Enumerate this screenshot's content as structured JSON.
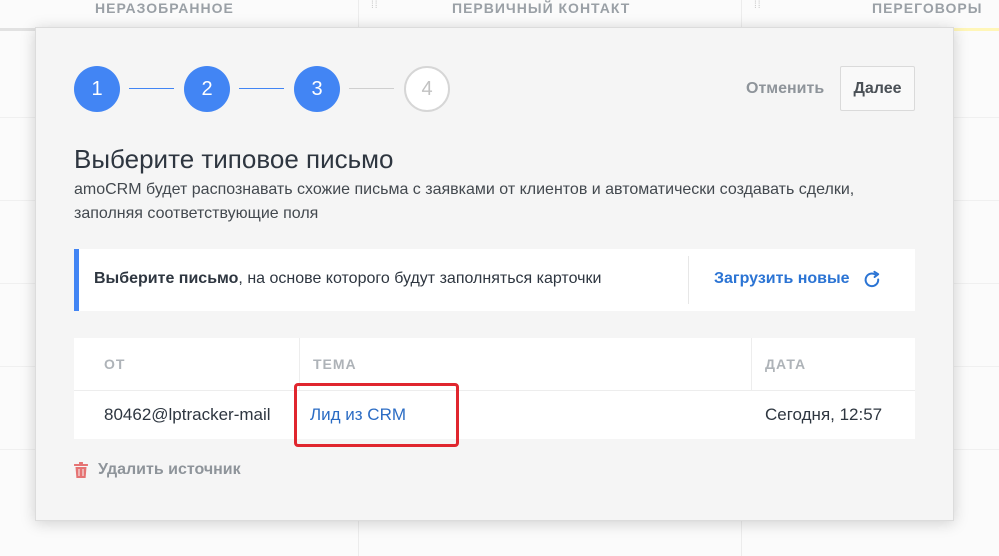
{
  "board": {
    "columns": [
      "НЕРАЗОБРАННОЕ",
      "ПЕРВИЧНЫЙ КОНТАКТ",
      "ПЕРЕГОВОРЫ"
    ]
  },
  "wizard": {
    "steps": [
      {
        "number": "1",
        "state": "done"
      },
      {
        "number": "2",
        "state": "done"
      },
      {
        "number": "3",
        "state": "done"
      },
      {
        "number": "4",
        "state": "todo"
      }
    ],
    "cancel_label": "Отменить",
    "next_label": "Далее"
  },
  "content": {
    "title": "Выберите типовое письмо",
    "subtitle": "amoCRM будет распознавать схожие письма с заявками от клиентов и автоматически создавать сделки, заполняя соответствующие поля"
  },
  "info": {
    "bold_text": "Выберите письмо",
    "rest_text": ", на основе которого будут заполняться карточки",
    "reload_label": "Загрузить новые",
    "reload_icon": "refresh-icon"
  },
  "table": {
    "headers": {
      "from": "ОТ",
      "subject": "ТЕМА",
      "date": "ДАТА"
    },
    "rows": [
      {
        "from": "80462@lptracker-mail",
        "subject": "Лид из CRM",
        "date": "Сегодня, 12:57"
      }
    ]
  },
  "footer": {
    "delete_label": "Удалить источник",
    "delete_icon": "trash-icon"
  },
  "colors": {
    "accent": "#4285f4",
    "link": "#2b74d4",
    "highlight": "#e0262e",
    "danger_icon": "#e57373"
  }
}
